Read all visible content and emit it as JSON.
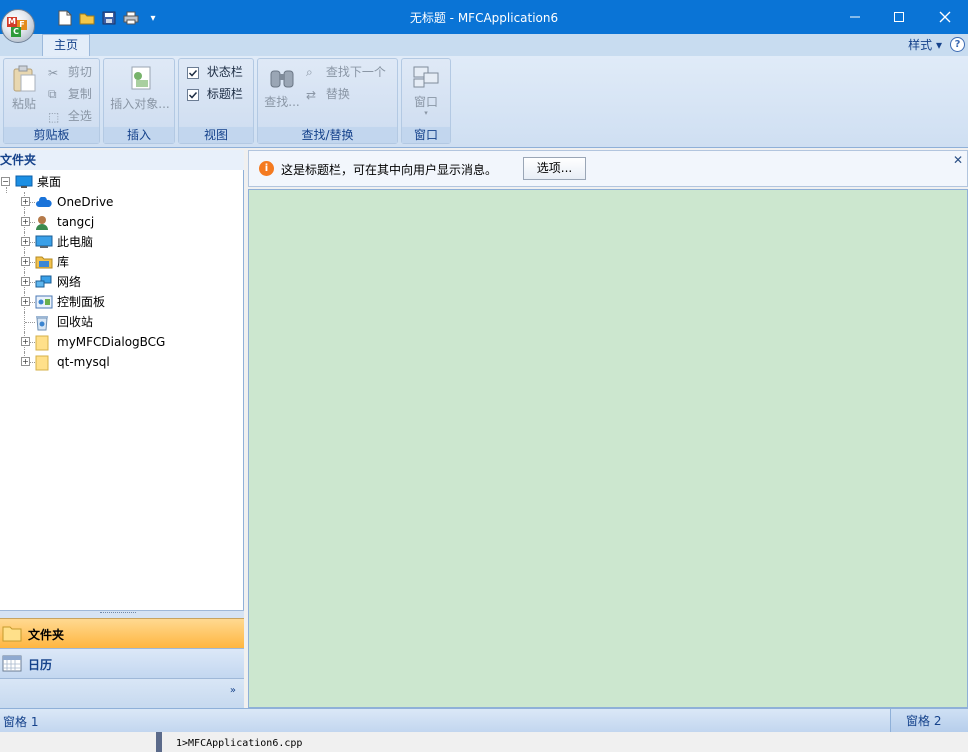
{
  "window": {
    "title": "无标题 - MFCApplication6"
  },
  "quick_access": {
    "icons": [
      "new-file-icon",
      "open-folder-icon",
      "save-icon",
      "print-icon",
      "customize-arrow-icon"
    ]
  },
  "ribbon": {
    "tab_home": "主页",
    "style_menu": "样式 ▾",
    "groups": {
      "clipboard": {
        "label": "剪贴板",
        "paste": "粘贴",
        "cut": "剪切",
        "copy": "复制",
        "select_all": "全选"
      },
      "insert": {
        "label": "插入",
        "insert_object": "插入对象..."
      },
      "view": {
        "label": "视图",
        "status_bar": "状态栏",
        "title_bar": "标题栏"
      },
      "find": {
        "label": "查找/替换",
        "find": "查找...",
        "find_next": "查找下一个",
        "replace": "替换"
      },
      "window": {
        "label": "窗口",
        "window": "窗口"
      }
    }
  },
  "folder_pane": {
    "header": "文件夹",
    "tree": [
      {
        "label": "桌面",
        "icon": "desktop-icon"
      },
      {
        "label": "OneDrive",
        "icon": "cloud-icon"
      },
      {
        "label": "tangcj",
        "icon": "user-icon"
      },
      {
        "label": "此电脑",
        "icon": "computer-icon"
      },
      {
        "label": "库",
        "icon": "library-icon"
      },
      {
        "label": "网络",
        "icon": "network-icon"
      },
      {
        "label": "控制面板",
        "icon": "control-panel-icon"
      },
      {
        "label": "回收站",
        "icon": "recycle-bin-icon"
      },
      {
        "label": "myMFCDialogBCG",
        "icon": "folder-icon"
      },
      {
        "label": "qt-mysql",
        "icon": "folder-icon"
      }
    ],
    "nav_folder": "文件夹",
    "nav_calendar": "日历"
  },
  "message_bar": {
    "text": "这是标题栏，可在其中向用户显示消息。",
    "button": "选项..."
  },
  "status_bar": {
    "pane1": "窗格 1",
    "pane2": "窗格 2"
  },
  "background_output": {
    "line": "1>MFCApplication6.cpp"
  }
}
